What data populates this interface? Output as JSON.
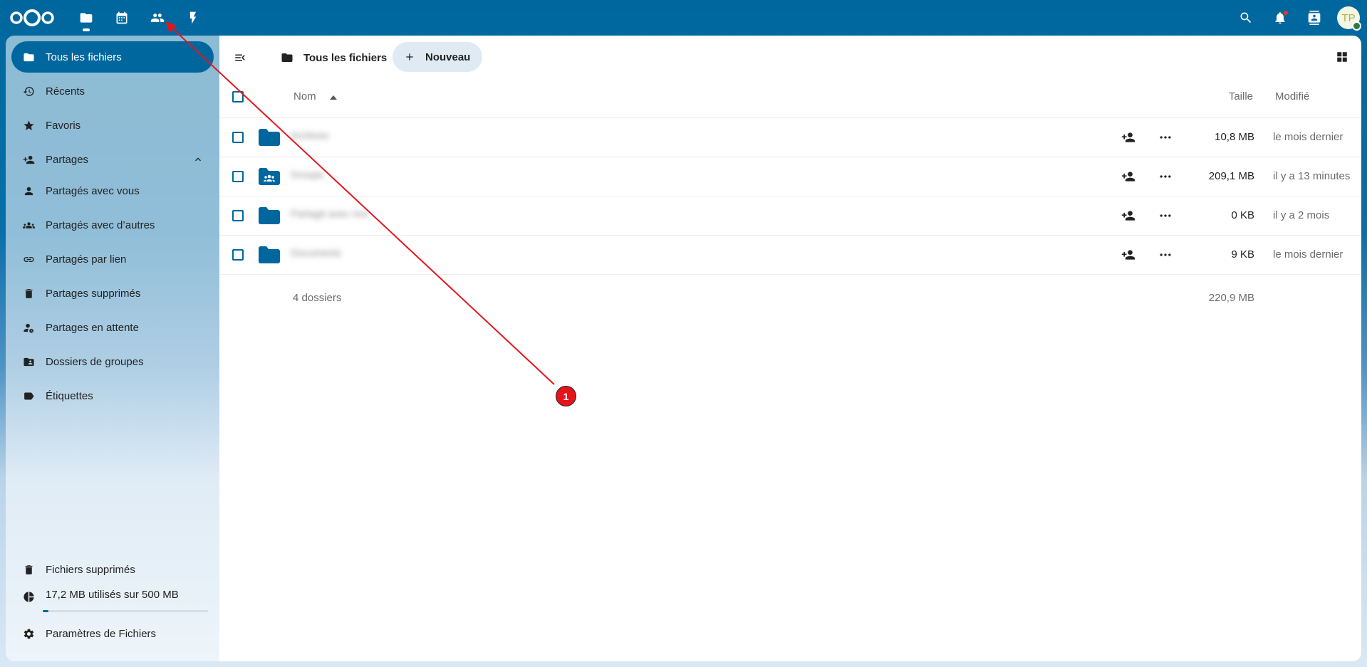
{
  "header": {
    "apps": [
      {
        "name": "files-app-icon",
        "active": true
      },
      {
        "name": "calendar-app-icon",
        "active": false
      },
      {
        "name": "contacts-app-icon",
        "active": false
      },
      {
        "name": "activity-app-icon",
        "active": false
      }
    ],
    "avatar_initials": "TP"
  },
  "sidebar": {
    "items": [
      {
        "label": "Tous les fichiers",
        "icon": "folder-icon",
        "active": true
      },
      {
        "label": "Récents",
        "icon": "history-icon"
      },
      {
        "label": "Favoris",
        "icon": "star-icon"
      },
      {
        "label": "Partages",
        "icon": "share-icon"
      },
      {
        "label": "Partagés avec vous",
        "icon": "account-icon"
      },
      {
        "label": "Partagés avec d’autres",
        "icon": "account-group-icon"
      },
      {
        "label": "Partagés par lien",
        "icon": "link-icon"
      },
      {
        "label": "Partages supprimés",
        "icon": "trash-icon"
      },
      {
        "label": "Partages en attente",
        "icon": "account-clock-icon"
      },
      {
        "label": "Dossiers de groupes",
        "icon": "folder-account-icon"
      },
      {
        "label": "Étiquettes",
        "icon": "tag-icon"
      }
    ],
    "footer": {
      "trash_label": "Fichiers supprimés",
      "quota_label": "17,2 MB utilisés sur 500 MB",
      "quota_fraction": 0.034,
      "settings_label": "Paramètres de Fichiers"
    }
  },
  "main": {
    "breadcrumb": "Tous les fichiers",
    "new_button": "Nouveau",
    "columns": {
      "name": "Nom",
      "size": "Taille",
      "modified": "Modifié"
    },
    "rows": [
      {
        "name": "Archives",
        "type": "folder",
        "size": "10,8 MB",
        "modified": "le mois dernier"
      },
      {
        "name": "Groupe",
        "type": "group-folder",
        "size": "209,1 MB",
        "modified": "il y a 13 minutes"
      },
      {
        "name": "Partagé avec moi",
        "type": "folder",
        "size": "0 KB",
        "modified": "il y a 2 mois"
      },
      {
        "name": "Documents",
        "type": "folder",
        "size": "9 KB",
        "modified": "le mois dernier"
      }
    ],
    "summary": {
      "count": "4 dossiers",
      "size": "220,9 MB"
    }
  },
  "annotation": {
    "marker_label": "1",
    "color": "#e5141b"
  },
  "colors": {
    "brand": "#00679e",
    "accent_light": "#dfeaf3"
  }
}
